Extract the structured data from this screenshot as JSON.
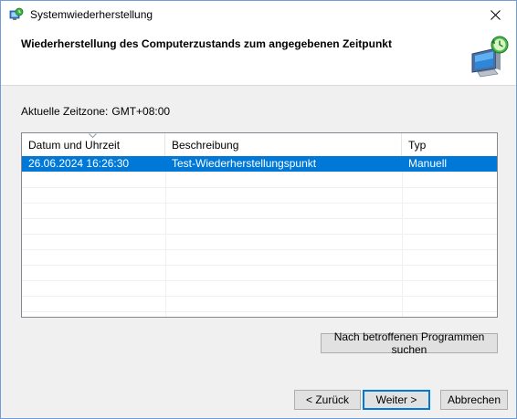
{
  "window": {
    "title": "Systemwiederherstellung"
  },
  "header": {
    "title": "Wiederherstellung des Computerzustands zum angegebenen Zeitpunkt"
  },
  "timezone": {
    "label": "Aktuelle Zeitzone:",
    "value": "GMT+08:00"
  },
  "restore_list": {
    "columns": [
      "Datum und Uhrzeit",
      "Beschreibung",
      "Typ"
    ],
    "sorted_column": "Datum und Uhrzeit",
    "rows": [
      {
        "date": "26.06.2024 16:26:30",
        "description": "Test-Wiederherstellungspunkt",
        "type": "Manuell",
        "selected": true
      }
    ]
  },
  "buttons": {
    "affected_programs": "Nach betroffenen Programmen suchen",
    "back": "< Zurück",
    "next": "Weiter >",
    "cancel": "Abbrechen"
  },
  "colors": {
    "selection": "#0078d7",
    "window_bg": "#f0f0f0",
    "border": "#6f9dd6"
  }
}
